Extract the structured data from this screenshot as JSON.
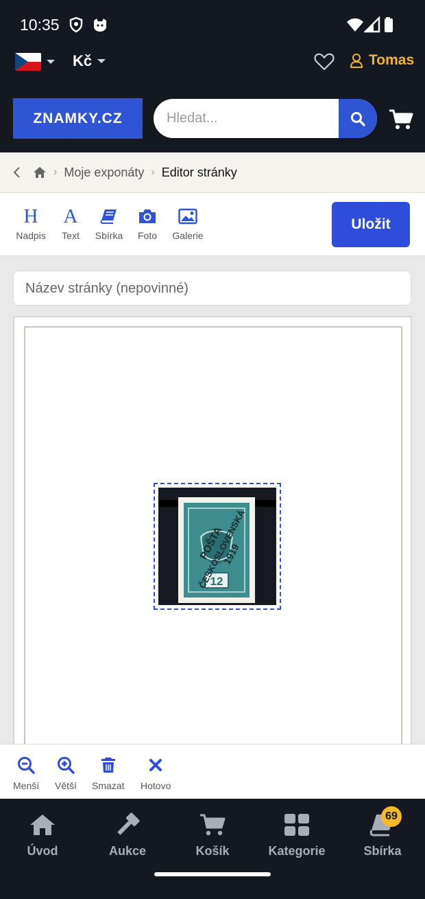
{
  "status": {
    "time": "10:35"
  },
  "header": {
    "currency": "Kč",
    "user_name": "Tomas",
    "logo_text": "ZNAMKY.CZ",
    "search_placeholder": "Hledat..."
  },
  "breadcrumb": {
    "parent": "Moje exponáty",
    "current": "Editor stránky"
  },
  "toolbar": {
    "tools": [
      {
        "label": "Nadpis",
        "icon": "heading-icon"
      },
      {
        "label": "Text",
        "icon": "text-icon"
      },
      {
        "label": "Sbírka",
        "icon": "book-icon"
      },
      {
        "label": "Foto",
        "icon": "camera-icon"
      },
      {
        "label": "Galerie",
        "icon": "gallery-icon"
      }
    ],
    "save_label": "Uložit"
  },
  "editor": {
    "title_placeholder": "Název stránky (nepovinné)"
  },
  "editbar": {
    "items": [
      {
        "label": "Menší",
        "icon": "zoom-out-icon"
      },
      {
        "label": "Větší",
        "icon": "zoom-in-icon"
      },
      {
        "label": "Smazat",
        "icon": "trash-icon"
      },
      {
        "label": "Hotovo",
        "icon": "close-icon"
      }
    ]
  },
  "bottomnav": {
    "items": [
      {
        "label": "Úvod",
        "icon": "home-icon"
      },
      {
        "label": "Aukce",
        "icon": "gavel-icon"
      },
      {
        "label": "Košík",
        "icon": "cart-icon"
      },
      {
        "label": "Kategorie",
        "icon": "grid-icon"
      },
      {
        "label": "Sbírka",
        "icon": "collection-icon"
      }
    ],
    "collection_badge": "69"
  },
  "colors": {
    "primary": "#2f4ddb",
    "dark": "#141821",
    "accent": "#f3b333"
  }
}
